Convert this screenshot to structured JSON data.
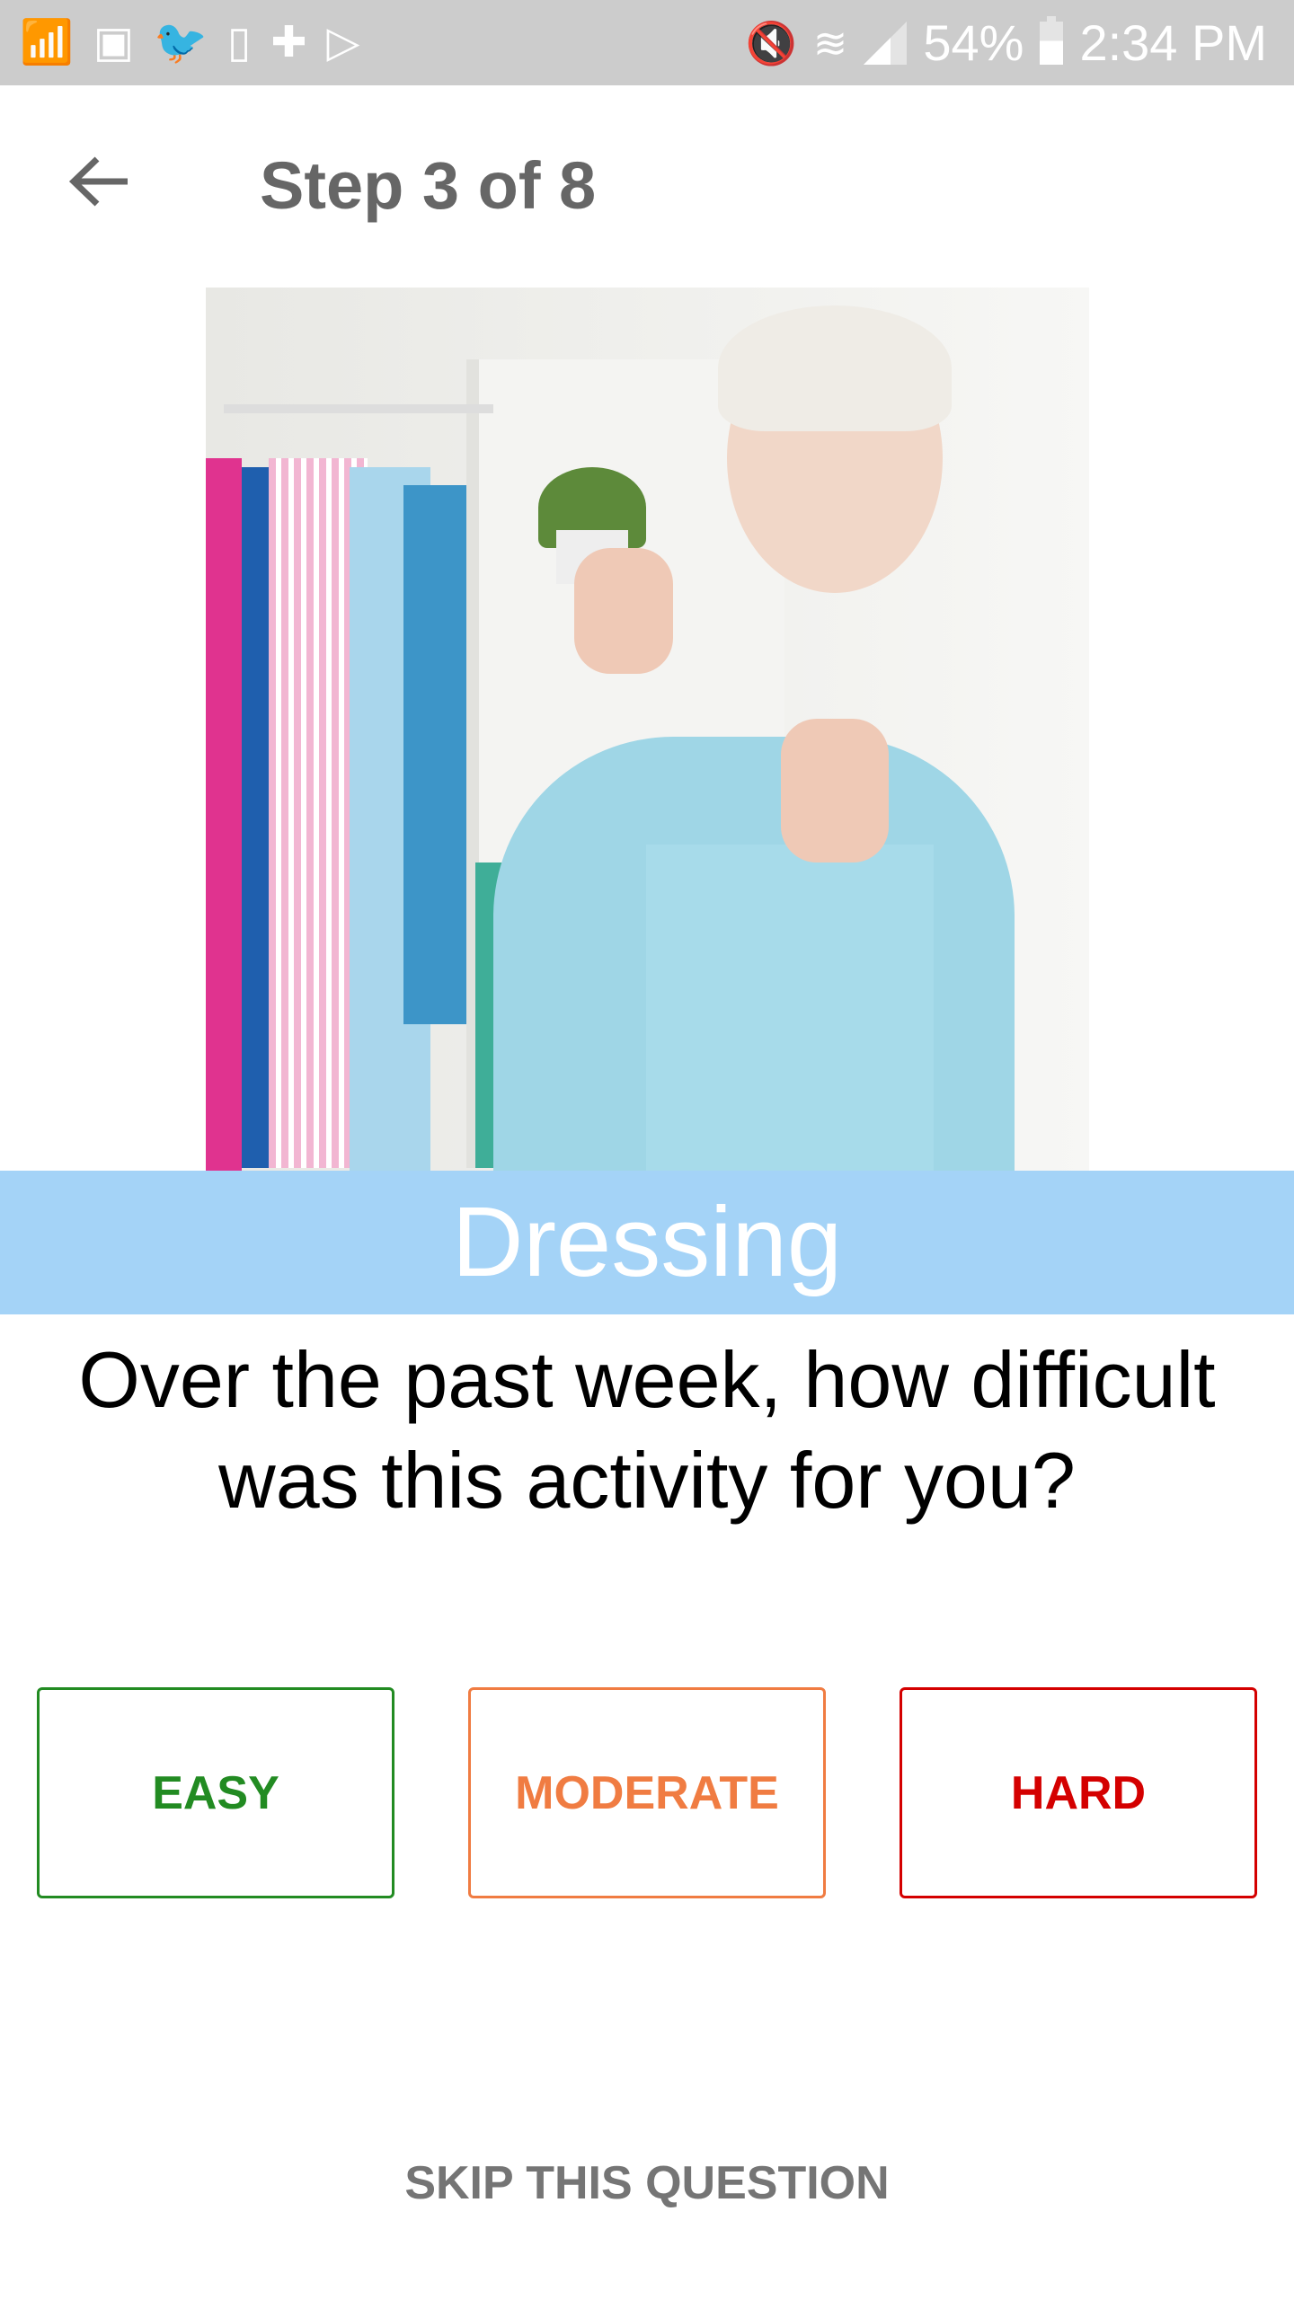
{
  "status_bar": {
    "left_icons": [
      "wifi-call-icon",
      "image-icon",
      "twitter-icon",
      "sim-icon",
      "health-plus-icon",
      "play-store-icon"
    ],
    "right_icons": [
      "vibrate-mute-icon",
      "wifi-icon",
      "signal-icon"
    ],
    "battery": "54%",
    "time": "2:34 PM"
  },
  "header": {
    "title": "Step 3 of 8"
  },
  "activity": {
    "label": "Dressing",
    "banner_color": "#a4d3f7"
  },
  "question": {
    "line1": "Over the past week, how difficult",
    "line2": "was this activity for you?"
  },
  "options": [
    {
      "label": "EASY",
      "color": "#228b22"
    },
    {
      "label": "MODERATE",
      "color": "#f07c42"
    },
    {
      "label": "HARD",
      "color": "#d40000"
    }
  ],
  "skip_label": "SKIP THIS QUESTION"
}
